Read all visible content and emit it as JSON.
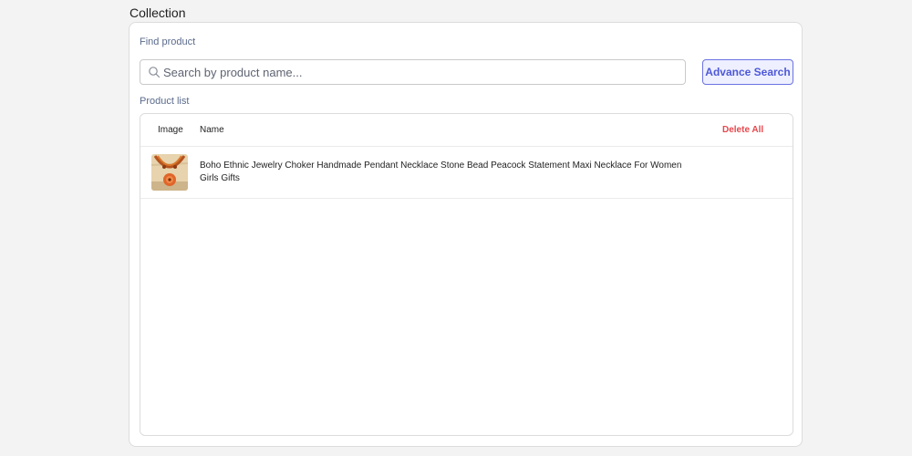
{
  "page": {
    "title": "Collection"
  },
  "find_product": {
    "label": "Find product",
    "search_placeholder": "Search by product name...",
    "search_value": "",
    "advance_search_label": "Advance Search"
  },
  "product_list": {
    "label": "Product list",
    "columns": {
      "image": "Image",
      "name": "Name"
    },
    "delete_all_label": "Delete All",
    "rows": [
      {
        "name": "Boho Ethnic Jewelry Choker Handmade Pendant Necklace Stone Bead Peacock Statement Maxi Necklace For Women Girls Gifts",
        "image_icon": "necklace-thumbnail"
      }
    ]
  },
  "colors": {
    "accent": "#4e58d8",
    "danger": "#e5484d",
    "label": "#5b6b8c"
  }
}
